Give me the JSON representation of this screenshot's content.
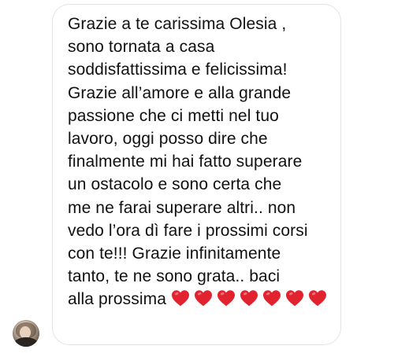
{
  "message": {
    "lines": [
      "Grazie a te carissima Olesia ,",
      "sono tornata a casa",
      "soddisfattissima e felicissima!",
      "Grazie all’amore e alla grande",
      "passione che ci metti nel tuo",
      "lavoro, oggi posso dire che",
      "finalmente mi hai fatto superare",
      "un ostacolo e sono certa che",
      "me ne farai superare altri.. non",
      "vedo l’ora dì fare i prossimi corsi",
      "con te!!! Grazie infinitamente",
      "tanto, te ne sono grata.. baci",
      "alla prossima"
    ],
    "emoji": "red-heart-icon",
    "heart_count": 7,
    "heart_color": "#e0232e"
  },
  "colors": {
    "bubble_border": "#e3e3e3",
    "text": "#111111",
    "background": "#ffffff"
  },
  "sender": {
    "avatar_icon": "profile-avatar"
  }
}
